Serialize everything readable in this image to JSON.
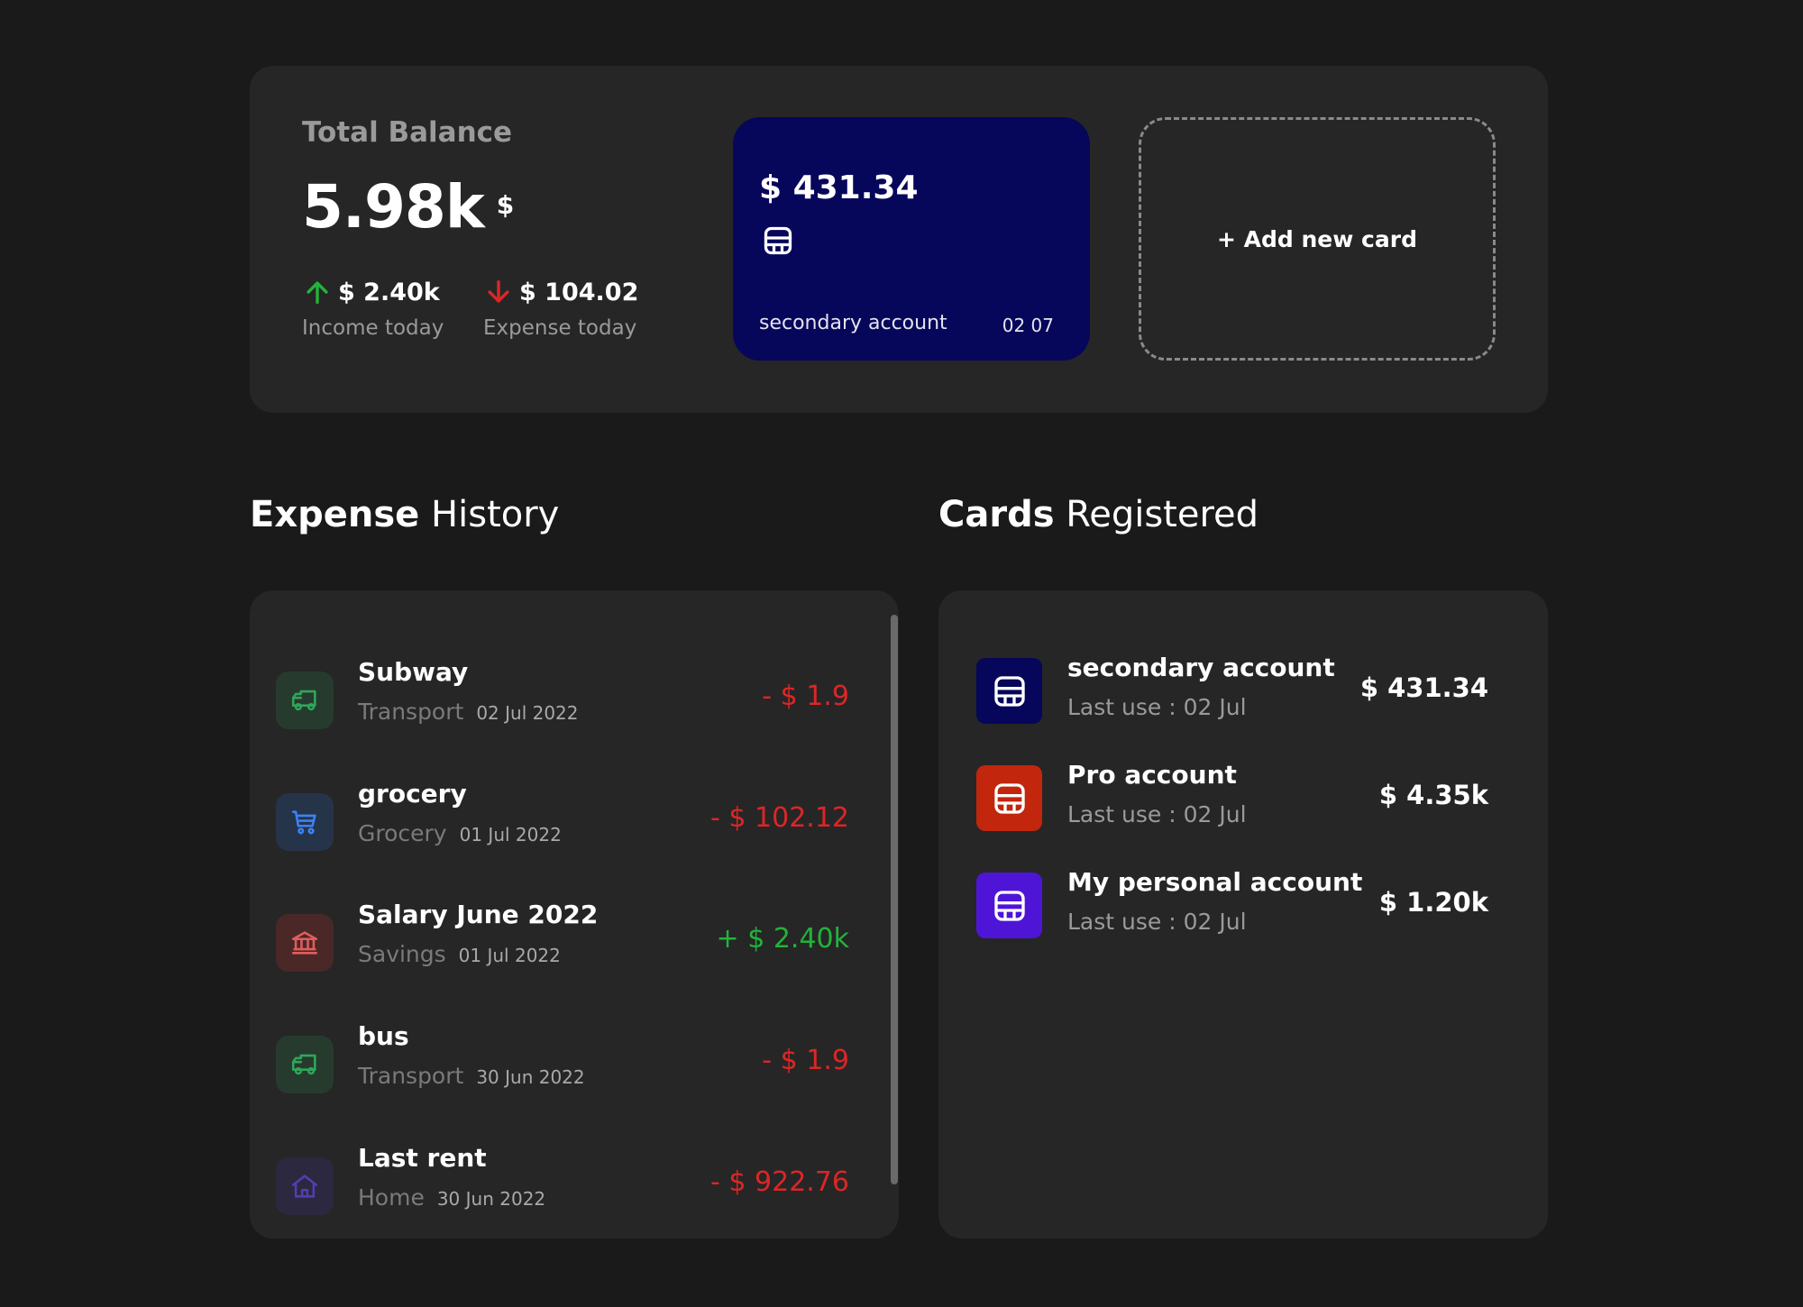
{
  "summary": {
    "title": "Total Balance",
    "total": "5.98k",
    "currency": "$",
    "income": {
      "value": "$ 2.40k",
      "label": "Income today"
    },
    "expense": {
      "value": "$ 104.02",
      "label": "Expense today"
    },
    "featured_card": {
      "amount": "$ 431.34",
      "name": "secondary account",
      "date": "02 07"
    },
    "add_card_label": "+ Add new card"
  },
  "expense_history": {
    "title_bold": "Expense",
    "title_light": "History",
    "items": [
      {
        "name": "Subway",
        "category": "Transport",
        "date": "02 Jul 2022",
        "amount": "- $ 1.9",
        "icon": "truck-icon",
        "color": "#16a34a"
      },
      {
        "name": "grocery",
        "category": "Grocery",
        "date": "01 Jul 2022",
        "amount": "- $ 102.12",
        "icon": "cart-icon",
        "color": "#3b82f6"
      },
      {
        "name": "Salary June 2022",
        "category": "Savings",
        "date": "01 Jul 2022",
        "amount": "+ $ 2.40k",
        "icon": "bank-icon",
        "color": "#dc2626"
      },
      {
        "name": "bus",
        "category": "Transport",
        "date": "30 Jun 2022",
        "amount": "- $ 1.9",
        "icon": "truck-icon",
        "color": "#16a34a"
      },
      {
        "name": "Last rent",
        "category": "Home",
        "date": "30 Jun 2022",
        "amount": "- $ 922.76",
        "icon": "home-icon",
        "color": "#4f3fb5"
      }
    ]
  },
  "cards_registered": {
    "title_bold": "Cards",
    "title_light": "Registered",
    "items": [
      {
        "name": "secondary account",
        "last_use": "Last use : 02 Jul",
        "amount": "$ 431.34",
        "color": "#06065a"
      },
      {
        "name": "Pro account",
        "last_use": "Last use : 02 Jul",
        "amount": "$ 4.35k",
        "color": "#c2260c"
      },
      {
        "name": "My personal account",
        "last_use": "Last use : 02 Jul",
        "amount": "$ 1.20k",
        "color": "#4f15d6"
      }
    ]
  },
  "colors": {
    "background": "#1a1a1a",
    "panel": "#262626",
    "negative": "#dc2626",
    "positive": "#22b33a"
  }
}
